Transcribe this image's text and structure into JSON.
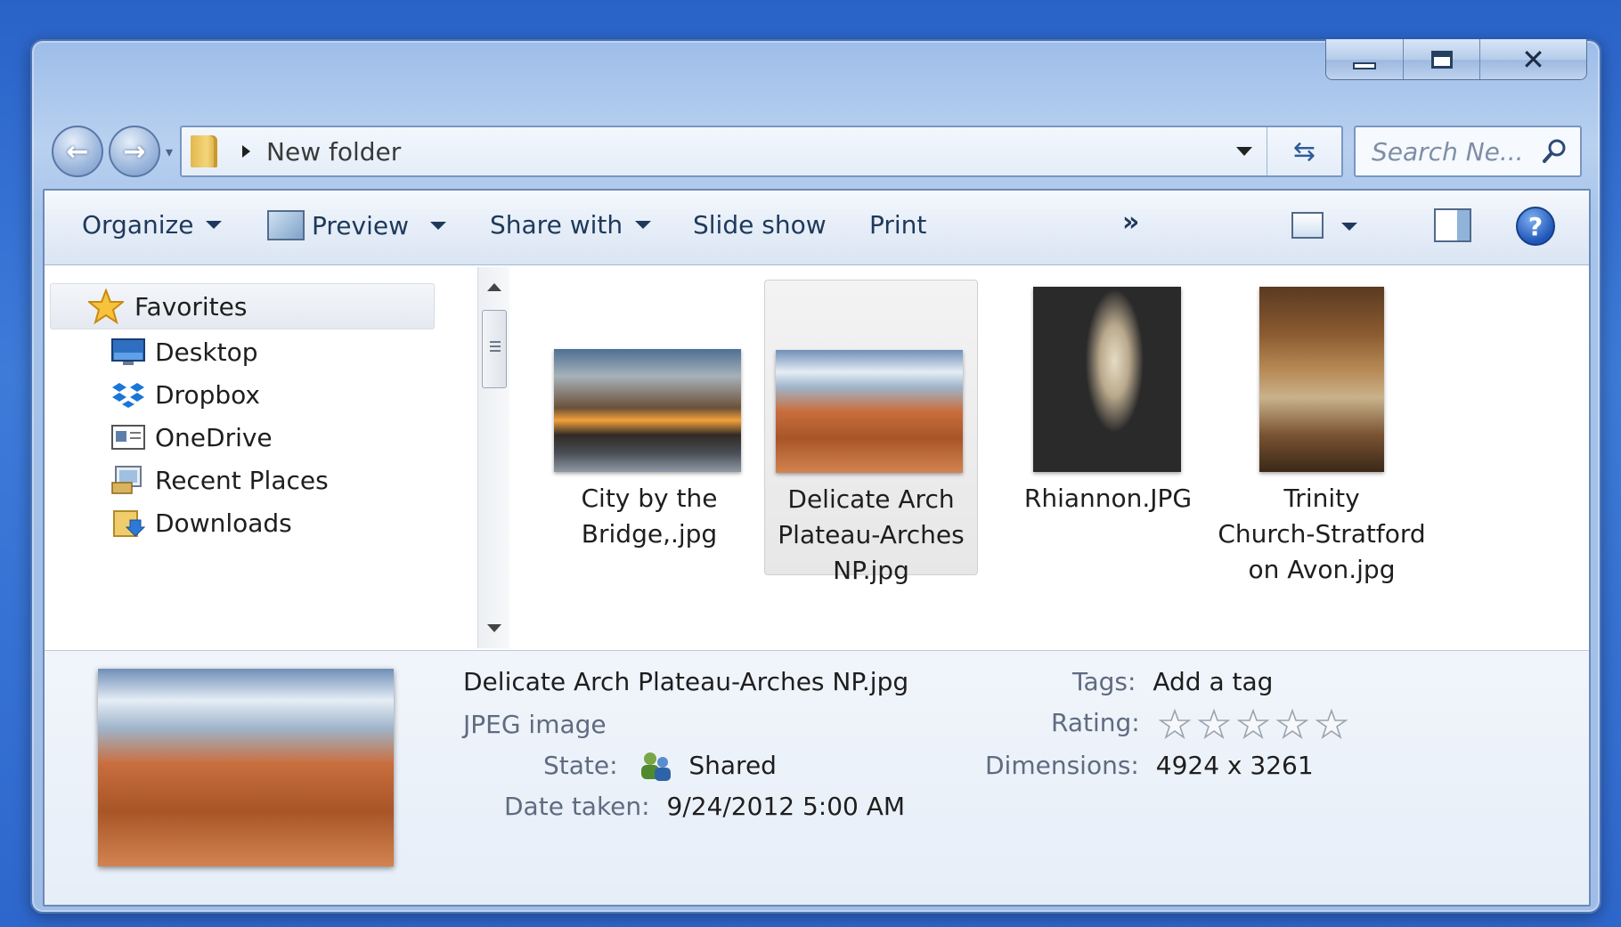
{
  "address": {
    "path": "New folder"
  },
  "search": {
    "placeholder": "Search Ne..."
  },
  "toolbar": {
    "organize": "Organize",
    "preview": "Preview",
    "share_with": "Share with",
    "slide_show": "Slide show",
    "print": "Print",
    "more": "»"
  },
  "navpane": {
    "favorites": "Favorites",
    "items": [
      {
        "label": "Desktop",
        "icon": "desktop-icon"
      },
      {
        "label": "Dropbox",
        "icon": "dropbox-icon"
      },
      {
        "label": "OneDrive",
        "icon": "onedrive-icon"
      },
      {
        "label": "Recent Places",
        "icon": "recent-places-icon"
      },
      {
        "label": "Downloads",
        "icon": "downloads-icon"
      }
    ]
  },
  "files": [
    {
      "name_line1": "City by the",
      "name_line2": "Bridge,.jpg",
      "name_line3": ""
    },
    {
      "name_line1": "Delicate Arch",
      "name_line2": "Plateau-Arches",
      "name_line3": "NP.jpg",
      "selected": true
    },
    {
      "name_line1": "Rhiannon.JPG",
      "name_line2": "",
      "name_line3": ""
    },
    {
      "name_line1": "Trinity",
      "name_line2": "Church-Stratford",
      "name_line3": "on Avon.jpg"
    }
  ],
  "details": {
    "filename": "Delicate Arch Plateau-Arches NP.jpg",
    "filetype": "JPEG image",
    "state_label": "State:",
    "state_value": "Shared",
    "date_label": "Date taken:",
    "date_value": "9/24/2012 5:00 AM",
    "tags_label": "Tags:",
    "tags_value": "Add a tag",
    "rating_label": "Rating:",
    "rating_value": 0,
    "rating_max": 5,
    "dimensions_label": "Dimensions:",
    "dimensions_value": "4924 x 3261"
  },
  "colors": {
    "window_frame": "#9dbde9",
    "selection": "#e7e7e7",
    "link_text": "#1e395b"
  }
}
